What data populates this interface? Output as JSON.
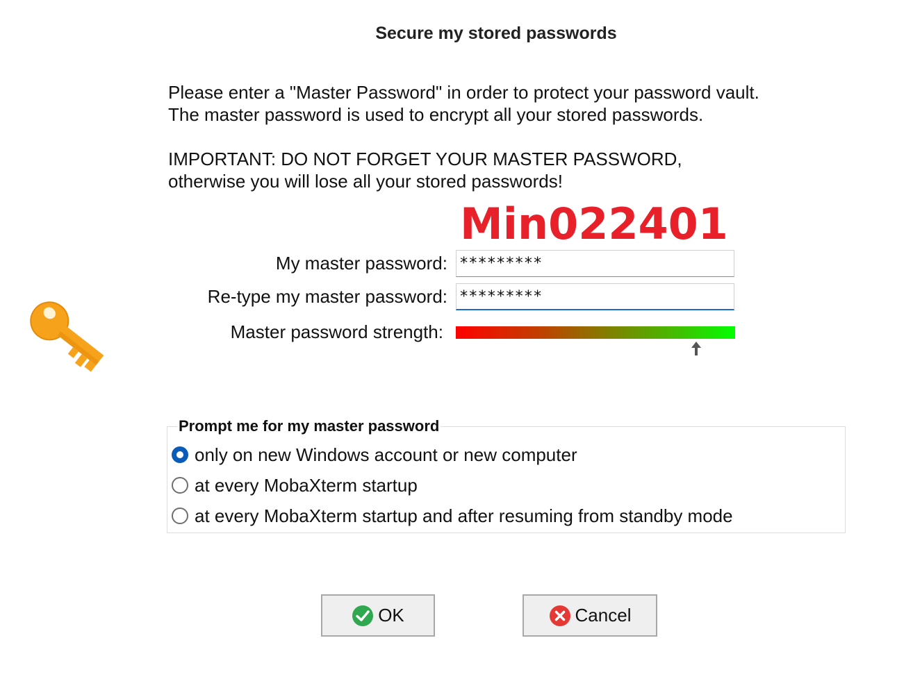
{
  "dialog": {
    "title": "Secure my stored passwords",
    "description_lines": [
      "Please enter a \"Master Password\" in order to protect your password vault.",
      "The master password is used to encrypt all your stored passwords.",
      "IMPORTANT:  DO NOT FORGET YOUR MASTER PASSWORD,",
      "otherwise you will lose all your stored passwords!"
    ],
    "annotation_text": "Min022401",
    "annotation_color": "#e8202a"
  },
  "form": {
    "master_label": "My master password:",
    "master_value": "*********",
    "retype_label": "Re-type my master password:",
    "retype_value": "*********",
    "strength_label": "Master password strength:",
    "strength_level": 0.86
  },
  "prompt_group": {
    "legend": "Prompt me for my master password",
    "options": [
      {
        "label": "only on new Windows account or new computer",
        "checked": true
      },
      {
        "label": "at every MobaXterm startup",
        "checked": false
      },
      {
        "label": "at every MobaXterm startup and after resuming from standby mode",
        "checked": false
      }
    ]
  },
  "buttons": {
    "ok_label": "OK",
    "cancel_label": "Cancel"
  },
  "icons": {
    "key": "key-icon",
    "ok": "check-circle-icon",
    "cancel": "x-circle-icon",
    "strength_marker": "arrow-up-icon"
  },
  "colors": {
    "accent": "#0b5cb8",
    "ok_green": "#2fa84f",
    "cancel_red": "#e53935",
    "key_orange": "#f7a21b"
  }
}
